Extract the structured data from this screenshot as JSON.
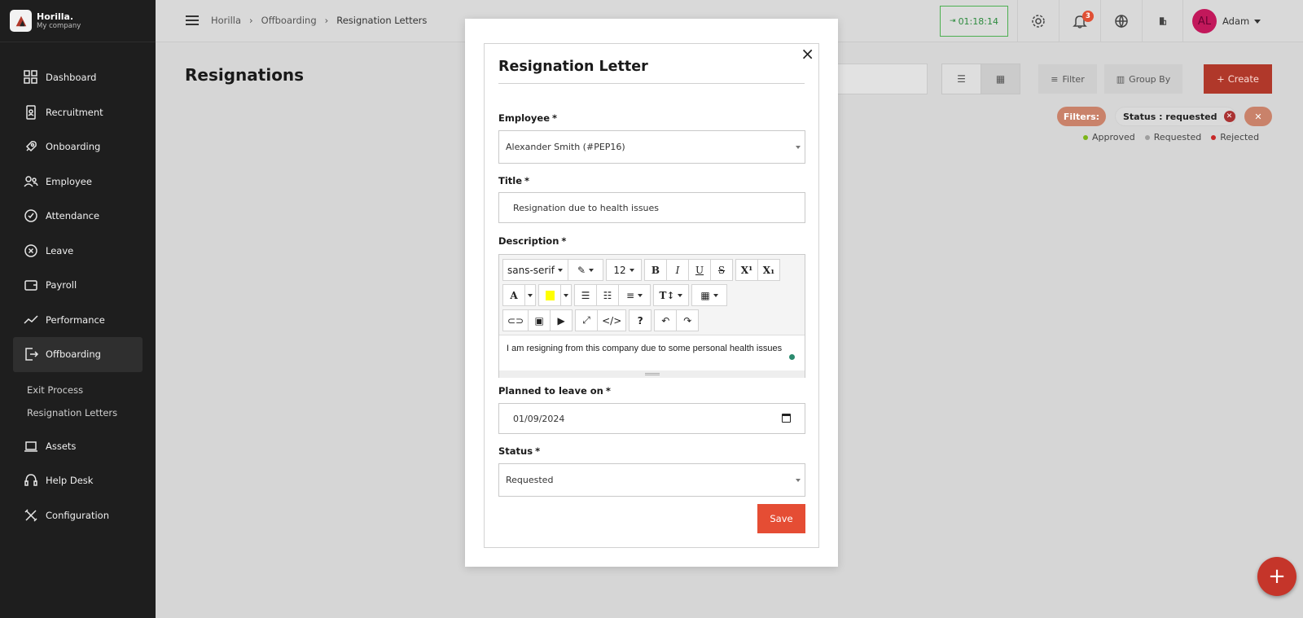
{
  "brand": {
    "name": "Horilla.",
    "company": "My company"
  },
  "sidebar": {
    "items": [
      {
        "label": "Dashboard",
        "icon": "dashboard-icon"
      },
      {
        "label": "Recruitment",
        "icon": "recruitment-icon"
      },
      {
        "label": "Onboarding",
        "icon": "rocket-icon"
      },
      {
        "label": "Employee",
        "icon": "users-icon"
      },
      {
        "label": "Attendance",
        "icon": "check-circle-icon"
      },
      {
        "label": "Leave",
        "icon": "x-circle-icon"
      },
      {
        "label": "Payroll",
        "icon": "wallet-icon"
      },
      {
        "label": "Performance",
        "icon": "trend-icon"
      },
      {
        "label": "Offboarding",
        "icon": "exit-icon"
      }
    ],
    "subitems": [
      "Exit Process",
      "Resignation Letters"
    ],
    "after": [
      {
        "label": "Assets",
        "icon": "laptop-icon"
      },
      {
        "label": "Help Desk",
        "icon": "headset-icon"
      },
      {
        "label": "Configuration",
        "icon": "tools-icon"
      }
    ]
  },
  "topbar": {
    "breadcrumb": [
      "Horilla",
      "Offboarding",
      "Resignation Letters"
    ],
    "timer": "01:18:14",
    "notifications": "3",
    "user_initials": "AL",
    "user_name": "Adam"
  },
  "page": {
    "title": "Resignations",
    "filter_label": "Filter",
    "group_by_label": "Group By",
    "create_label": "Create",
    "filters_tag": "Filters:",
    "active_filter": "Status : requested",
    "legend": [
      {
        "label": "Approved",
        "color": "#7cb518"
      },
      {
        "label": "Requested",
        "color": "#9e9e9e"
      },
      {
        "label": "Rejected",
        "color": "#c62828"
      }
    ]
  },
  "modal": {
    "title": "Resignation Letter",
    "employee_label": "Employee",
    "employee_value": "Alexander Smith (#PEP16)",
    "title_label": "Title",
    "title_value": "Resignation due to health issues",
    "description_label": "Description",
    "editor": {
      "font": "sans-serif",
      "size": "12",
      "content": "I am resigning from this company due to some personal health issues"
    },
    "planned_label": "Planned to leave on",
    "planned_value": "01/09/2024",
    "status_label": "Status",
    "status_value": "Requested",
    "save_label": "Save",
    "required_mark": "*"
  },
  "colors": {
    "accent": "#e54d34",
    "sidebar": "#1e1e1e"
  }
}
